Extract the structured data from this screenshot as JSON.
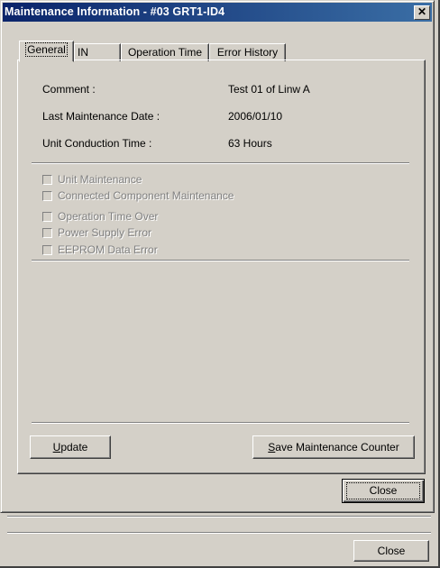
{
  "dialog": {
    "title": "Maintenance Information - #03 GRT1-ID4",
    "close_glyph": "✕"
  },
  "tabs": [
    {
      "label": "General",
      "active": true
    },
    {
      "label": "IN",
      "active": false
    },
    {
      "label": "Operation Time",
      "active": false
    },
    {
      "label": "Error History",
      "active": false
    }
  ],
  "general": {
    "fields": [
      {
        "label": "Comment :",
        "value": "Test 01 of Linw A"
      },
      {
        "label": "Last Maintenance Date :",
        "value": "2006/01/10"
      },
      {
        "label": "Unit Conduction Time :",
        "value": "63 Hours"
      }
    ],
    "checkboxes": [
      {
        "label": "Unit Maintenance",
        "checked": false,
        "enabled": false
      },
      {
        "label": "Connected Component Maintenance",
        "checked": false,
        "enabled": false
      },
      {
        "label": "Operation Time Over",
        "checked": false,
        "enabled": false
      },
      {
        "label": "Power Supply Error",
        "checked": false,
        "enabled": false
      },
      {
        "label": "EEPROM Data Error",
        "checked": false,
        "enabled": false
      }
    ]
  },
  "buttons": {
    "update": {
      "mnemonic": "U",
      "rest": "pdate"
    },
    "save_counter": {
      "mnemonic": "S",
      "rest": "ave Maintenance Counter"
    },
    "dialog_close": "Close",
    "window_close": "Close"
  },
  "colors": {
    "titlebar_start": "#0a246a",
    "titlebar_end": "#3a6ea5",
    "face": "#d4d0c8",
    "disabled_text": "#808080"
  }
}
